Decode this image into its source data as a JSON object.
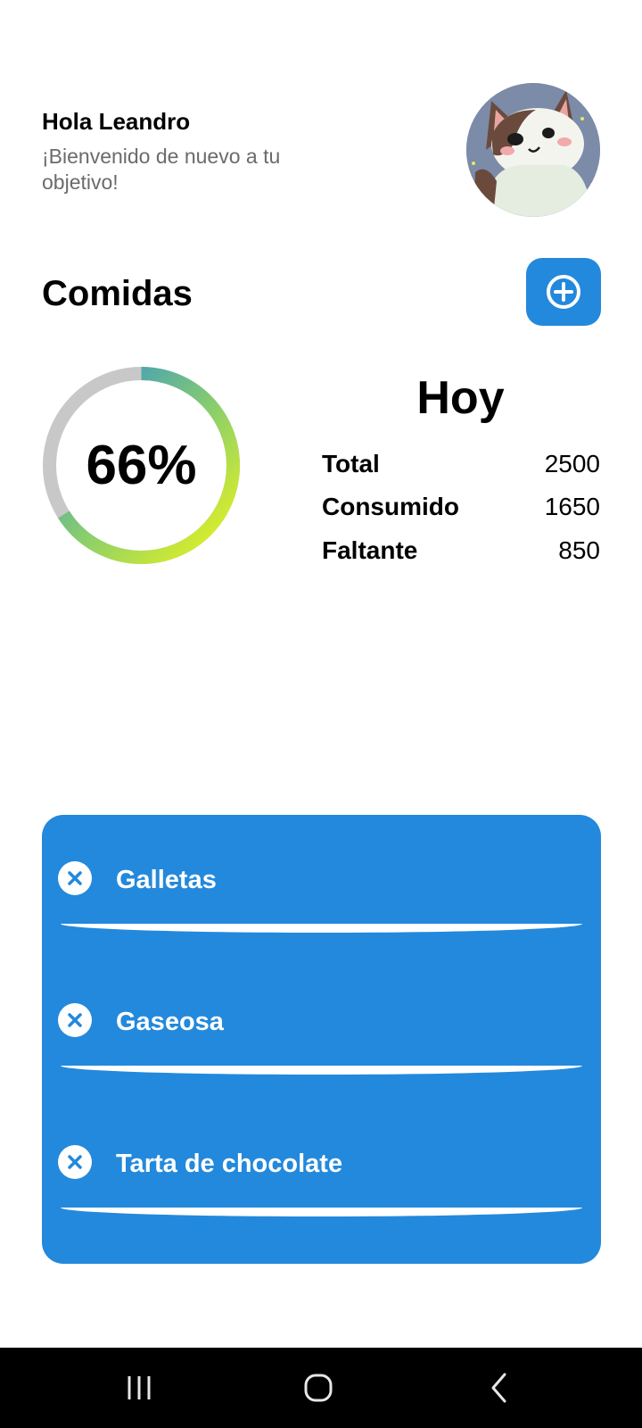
{
  "header": {
    "greeting": "Hola Leandro",
    "subtitle": "¡Bienvenido de nuevo a tu objetivo!"
  },
  "section": {
    "title": "Comidas"
  },
  "progress": {
    "percent_label": "66%",
    "percent_value": 66
  },
  "summary": {
    "title": "Hoy",
    "rows": [
      {
        "label": "Total",
        "value": "2500"
      },
      {
        "label": "Consumido",
        "value": "1650"
      },
      {
        "label": "Faltante",
        "value": "850"
      }
    ]
  },
  "meals": [
    {
      "name": "Galletas"
    },
    {
      "name": "Gaseosa"
    },
    {
      "name": "Tarta de chocolate"
    }
  ],
  "icons": {
    "add": "plus-circle-icon",
    "remove": "close-icon",
    "nav_recents": "recents-icon",
    "nav_home": "home-icon",
    "nav_back": "back-icon"
  },
  "colors": {
    "accent": "#2389dc",
    "ring_track": "#c8c8c8",
    "ring_gradient_start": "#eef51a",
    "ring_gradient_mid": "#8ccf6a",
    "ring_gradient_end": "#2389dc"
  }
}
